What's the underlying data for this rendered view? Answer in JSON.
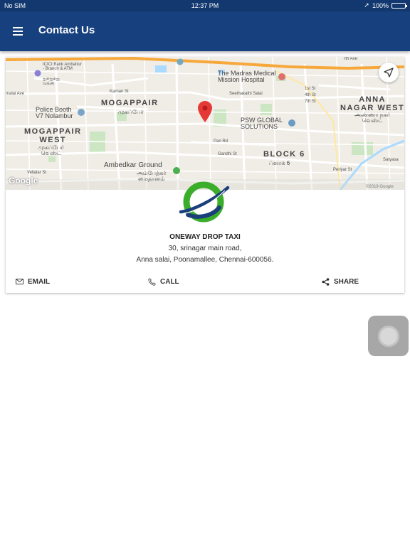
{
  "status_bar": {
    "carrier": "No SIM",
    "time": "12:37 PM",
    "battery": "100%"
  },
  "app_bar": {
    "title": "Contact Us"
  },
  "map": {
    "labels": {
      "icici": "ICICI Bank Ambattur\n- Branch & ATM",
      "icici_tamil": "ஐசிஐசிஐ\nவங்கி",
      "madras_medical": "The Madras Medical\nMission Hospital",
      "anna_nagar_west": "ANNA\nNAGAR WEST",
      "anna_nagar_tamil": "அண்ணா நகர்\nவெஸ்ட்",
      "mogappair": "MOGAPPAIR",
      "mogappair_tamil": "முகப்பேர்",
      "police_booth": "Police Booth\nV7 Nolambur",
      "mogappair_west": "MOGAPPAIR\nWEST",
      "mogappair_west_tamil": "முகப்பேர்\nவெஸ்ட்",
      "psw": "PSW GLOBAL\nSOLUTIONS",
      "block6": "BLOCK 6",
      "block6_tamil": "ப்ளாக் 6",
      "ambedkar": "Ambedkar Ground",
      "ambedkar_tamil": "அம்பேத்கர்\nமைதானம்",
      "karnan_st": "Karnan St",
      "seethakathi": "Seethakathi Salai",
      "malai_ave": "malai Ave",
      "pari_rd": "Pari Rd",
      "gandhi_st": "Gandhi St",
      "vellalar_st": "Vellalar St",
      "periyar_st": "Periyar St",
      "satyasa": "Satyasa",
      "ave_7th": "7th Ave",
      "st_1st": "1st St",
      "st_4th": "4th St",
      "st_7th": "7th St",
      "google": "Google",
      "copyright": "©2019 Google"
    }
  },
  "company": {
    "name": "ONEWAY DROP TAXI",
    "address_line1": "30, srinagar main road,",
    "address_line2": "Anna salai, Poonamallee, Chennai-600056."
  },
  "actions": {
    "email": "EMAIL",
    "call": "CALL",
    "share": "SHARE"
  },
  "icons": {
    "menu": "menu-icon",
    "locate": "navigation-arrow-icon",
    "email": "mail-icon",
    "call": "phone-icon",
    "share": "share-icon",
    "map_marker": "map-pin-icon",
    "logo": "oneway-drop-taxi-logo"
  },
  "colors": {
    "app_bar": "#17417e",
    "status_bar": "#12386f",
    "map_marker": "#e53935",
    "logo_green": "#3aae2a",
    "logo_blue": "#1b3f7a"
  }
}
